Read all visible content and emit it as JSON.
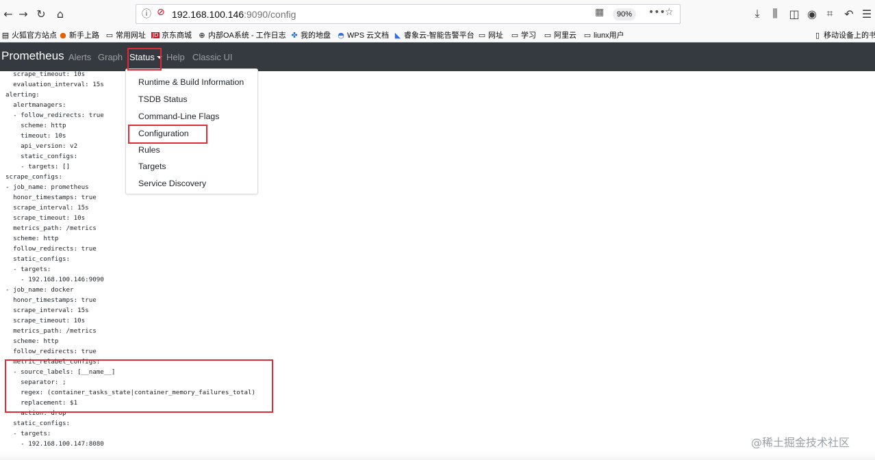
{
  "browser": {
    "url_host": "192.168.100.146",
    "url_rest": ":9090/config",
    "zoom": "90%",
    "nav_icons": [
      "back-icon",
      "forward-icon",
      "reload-icon",
      "home-icon"
    ],
    "right_icons": [
      "download-icon",
      "library-icon",
      "sidebar-icon",
      "account-icon",
      "screenshot-icon",
      "undo-icon",
      "menu-icon"
    ]
  },
  "bookmarks": [
    "火狐官方站点",
    "新手上路",
    "常用网址",
    "京东商城",
    "内部OA系统 - 工作日志",
    "我的地盘",
    "WPS 云文档",
    "睿象云-智能告警平台",
    "网址",
    "学习",
    "阿里云",
    "liunx用户",
    "移动设备上的书签"
  ],
  "navbar": {
    "brand": "Prometheus",
    "links": {
      "alerts": "Alerts",
      "graph": "Graph",
      "status": "Status",
      "help": "Help",
      "classic_ui": "Classic UI"
    }
  },
  "dropdown": {
    "items": [
      "Runtime & Build Information",
      "TSDB Status",
      "Command-Line Flags",
      "Configuration",
      "Rules",
      "Targets",
      "Service Discovery"
    ]
  },
  "config_lines": [
    "  scrape_timeout: 10s",
    "  evaluation_interval: 15s",
    "alerting:",
    "  alertmanagers:",
    "  - follow_redirects: true",
    "    scheme: http",
    "    timeout: 10s",
    "    api_version: v2",
    "    static_configs:",
    "    - targets: []",
    "scrape_configs:",
    "- job_name: prometheus",
    "  honor_timestamps: true",
    "  scrape_interval: 15s",
    "  scrape_timeout: 10s",
    "  metrics_path: /metrics",
    "  scheme: http",
    "  follow_redirects: true",
    "  static_configs:",
    "  - targets:",
    "    - 192.168.100.146:9090",
    "- job_name: docker",
    "  honor_timestamps: true",
    "  scrape_interval: 15s",
    "  scrape_timeout: 10s",
    "  metrics_path: /metrics",
    "  scheme: http",
    "  follow_redirects: true",
    "  metric_relabel_configs:",
    "  - source_labels: [__name__]",
    "    separator: ;",
    "    regex: (container_tasks_state|container_memory_failures_total)",
    "    replacement: $1",
    "    action: drop",
    "  static_configs:",
    "  - targets:",
    "    - 192.168.100.147:8080"
  ],
  "watermark": "@稀土掘金技术社区",
  "colors": {
    "navbar_bg": "#343a40",
    "annotation_red": "#e02a34"
  }
}
